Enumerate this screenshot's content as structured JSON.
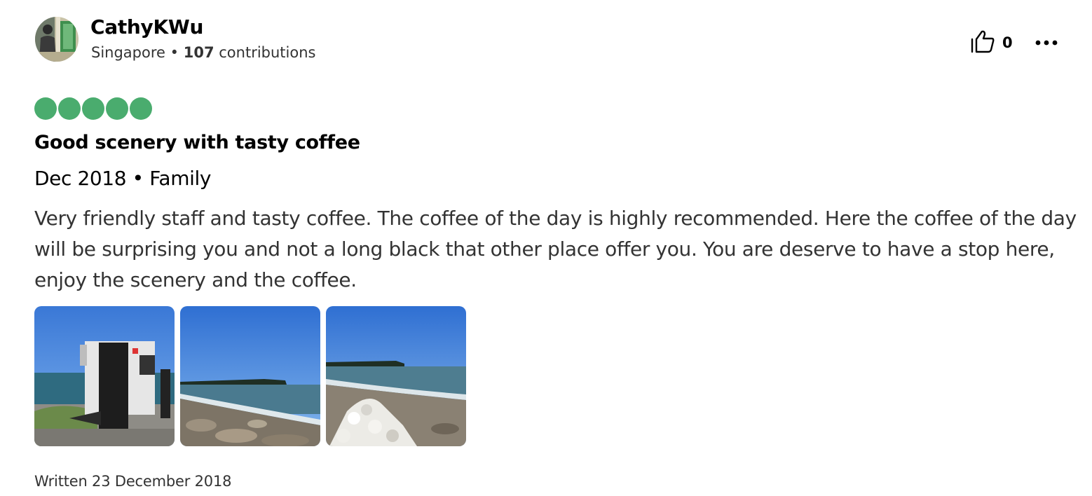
{
  "review": {
    "author": {
      "name": "CathyKWu",
      "location": "Singapore",
      "separator": "•",
      "contributions_count": "107",
      "contributions_label": "contributions"
    },
    "actions": {
      "helpful_count": "0",
      "helpful_icon": "thumbs-up-icon",
      "more_icon": "more-options-icon"
    },
    "rating": {
      "value": 5,
      "max": 5,
      "color": "#4aac6e"
    },
    "title": "Good scenery with tasty coffee",
    "trip": {
      "date": "Dec 2018",
      "separator": "•",
      "type": "Family"
    },
    "text": "Very friendly staff and tasty coffee. The coffee of the day is highly recommended. Here the coffee of the day will be surprising you and not a long black that other place offer you. You are deserve to have a stop here, enjoy the scenery and the coffee.",
    "photos_count": 3,
    "written_date": "Written 23 December 2018"
  }
}
